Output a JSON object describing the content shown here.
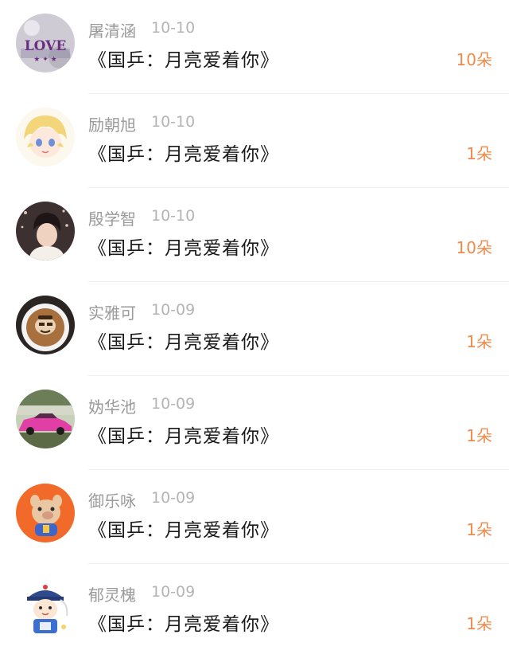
{
  "gifts": [
    {
      "user": "屠清涵",
      "date": "10-10",
      "item": "《国乒：月亮爱着你》",
      "count": "10朵",
      "avatar_icon": "love-text-avatar",
      "avatar_color": "#c9c6cf"
    },
    {
      "user": "励朝旭",
      "date": "10-10",
      "item": "《国乒：月亮爱着你》",
      "count": "1朵",
      "avatar_icon": "anime-girl-avatar",
      "avatar_color": "#f6e7b4"
    },
    {
      "user": "殷学智",
      "date": "10-10",
      "item": "《国乒：月亮爱着你》",
      "count": "10朵",
      "avatar_icon": "man-portrait-avatar",
      "avatar_color": "#4a3b3b"
    },
    {
      "user": "实雅可",
      "date": "10-09",
      "item": "《国乒：月亮爱着你》",
      "count": "1朵",
      "avatar_icon": "latte-art-avatar",
      "avatar_color": "#b07a4a"
    },
    {
      "user": "妫华池",
      "date": "10-09",
      "item": "《国乒：月亮爱着你》",
      "count": "1朵",
      "avatar_icon": "pink-car-avatar",
      "avatar_color": "#e23fa6"
    },
    {
      "user": "御乐咏",
      "date": "10-09",
      "item": "《国乒：月亮爱着你》",
      "count": "1朵",
      "avatar_icon": "cartoon-pig-avatar",
      "avatar_color": "#f26a2a"
    },
    {
      "user": "郁灵槐",
      "date": "10-09",
      "item": "《国乒：月亮爱着你》",
      "count": "1朵",
      "avatar_icon": "qing-official-avatar",
      "avatar_color": "#2f5aa6"
    }
  ],
  "theme": {
    "accent": "#ef8a4a",
    "name_color": "#9a9a9a",
    "title_color": "#1a1a1a"
  }
}
